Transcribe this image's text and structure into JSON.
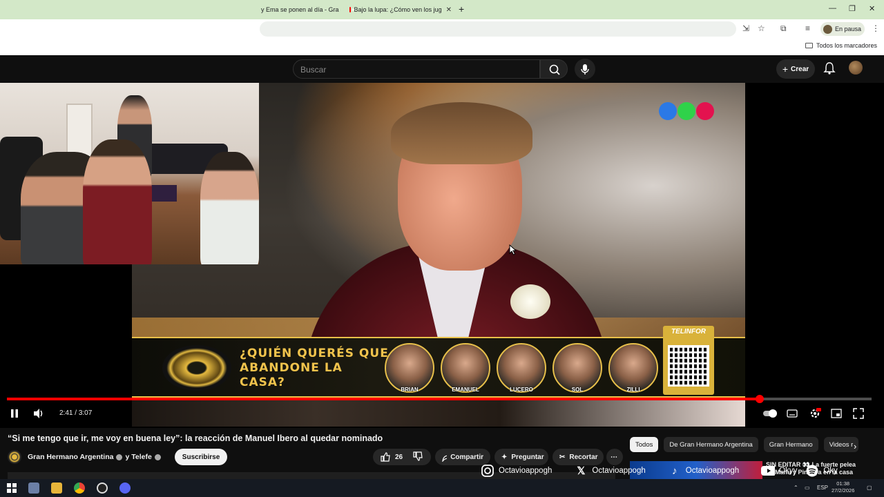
{
  "browser": {
    "tabs": [
      {
        "label": "y Ema se ponen al día - Gra",
        "favicon": "page-icon"
      },
      {
        "label": "Bajo la lupa: ¿Cómo ven los jug",
        "favicon": "youtube-icon"
      }
    ],
    "profile_status": "En pausa",
    "bookmarks_label": "Todos los marcadores"
  },
  "youtube": {
    "search_placeholder": "Buscar",
    "create_label": "Crear"
  },
  "video": {
    "banner_question": "¿QUIÉN QUERÉS QUE ABANDONE LA CASA?",
    "candidates": [
      "BRIAN",
      "EMANUEL",
      "LUCERO",
      "SOL",
      "ZILLI"
    ],
    "sponsor": "TELINFOR",
    "channel_dot_colors": [
      "#2b79e6",
      "#2fd24a",
      "#e3124f"
    ],
    "progress_fraction": 0.871,
    "time_current": "2:41",
    "time_separator": "/",
    "time_total": "3:07"
  },
  "details": {
    "title": "“Si me tengo que ir, me voy en buena ley”: la reacción de Manuel Ibero al quedar nominado",
    "channel": "Gran Hermano Argentina",
    "channel_and": "y Telefe",
    "subscribe": "Suscribirse",
    "likes": "26",
    "share": "Compartir",
    "ask": "Preguntar",
    "clip": "Recortar"
  },
  "chips": [
    "Todos",
    "De Gran Hermano Argentina",
    "Gran Hermano",
    "Videos r"
  ],
  "side_video": {
    "title": "SIN EDITAR 👀 La fuerte pelea de Manu y Pinasya en la casa"
  },
  "overlay_socials": [
    {
      "icon": "instagram-icon",
      "handle": "Octavioappogh"
    },
    {
      "icon": "x-icon",
      "handle": "Octavioappogh"
    },
    {
      "icon": "tiktok-icon",
      "handle": "Octavioappogh"
    },
    {
      "icon": "youtube-icon",
      "handle": "Okyy"
    },
    {
      "icon": "spotify-icon",
      "handle": "Oky"
    }
  ],
  "taskbar": {
    "lang": "ESP",
    "time": "01:38",
    "date": "27/2/2026"
  }
}
